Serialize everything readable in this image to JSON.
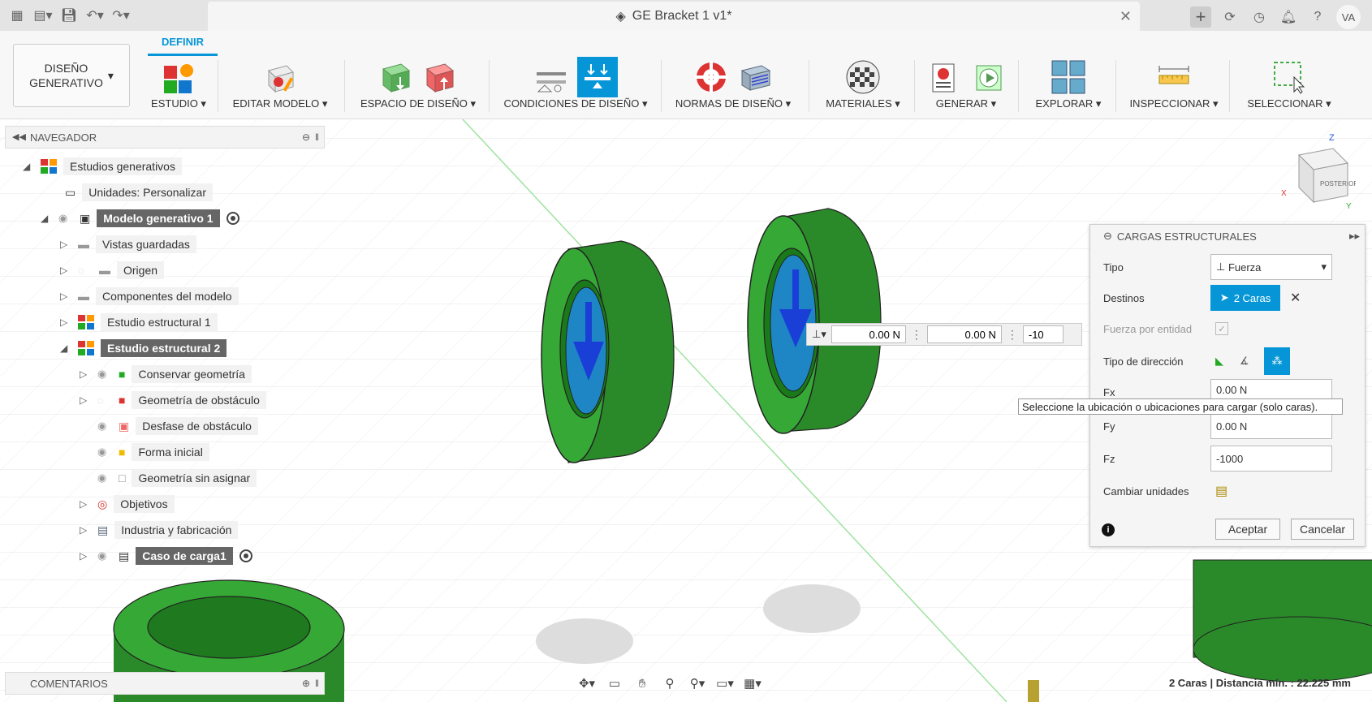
{
  "window": {
    "title": "GE Bracket 1 v1*",
    "avatar": "VA"
  },
  "ribbon": {
    "workspace": "DISEÑO\nGENERATIVO",
    "active_tab": "DEFINIR",
    "groups": [
      {
        "label": "ESTUDIO ▾"
      },
      {
        "label": "EDITAR MODELO ▾"
      },
      {
        "label": "ESPACIO DE DISEÑO ▾"
      },
      {
        "label": "CONDICIONES DE DISEÑO ▾"
      },
      {
        "label": "NORMAS DE DISEÑO ▾"
      },
      {
        "label": "MATERIALES ▾"
      },
      {
        "label": "GENERAR ▾"
      },
      {
        "label": "EXPLORAR ▾"
      },
      {
        "label": "INSPECCIONAR ▾"
      },
      {
        "label": "SELECCIONAR ▾"
      }
    ]
  },
  "navigator": {
    "title": "NAVEGADOR",
    "items": [
      {
        "label": "Estudios generativos"
      },
      {
        "label": "Unidades: Personalizar"
      },
      {
        "label": "Modelo generativo 1"
      },
      {
        "label": "Vistas guardadas"
      },
      {
        "label": "Origen"
      },
      {
        "label": "Componentes del modelo"
      },
      {
        "label": "Estudio estructural 1"
      },
      {
        "label": "Estudio estructural 2"
      },
      {
        "label": "Conservar geometría"
      },
      {
        "label": "Geometría de obstáculo"
      },
      {
        "label": "Desfase de obstáculo"
      },
      {
        "label": "Forma inicial"
      },
      {
        "label": "Geometría sin asignar"
      },
      {
        "label": "Objetivos"
      },
      {
        "label": "Industria y fabricación"
      },
      {
        "label": "Caso de carga1"
      }
    ]
  },
  "field_bar": {
    "fx": "0.00 N",
    "fy": "0.00 N",
    "fz": "-10"
  },
  "dialog": {
    "title": "CARGAS ESTRUCTURALES",
    "tipo_label": "Tipo",
    "tipo_value": "Fuerza",
    "destinos_label": "Destinos",
    "destinos_value": "2 Caras",
    "fuerza_entidad_label": "Fuerza por entidad",
    "tipo_direccion_label": "Tipo de dirección",
    "fx_label": "Fx",
    "fx_value": "0.00 N",
    "fy_label": "Fy",
    "fy_value": "0.00 N",
    "fz_label": "Fz",
    "fz_value": "-1000",
    "cambiar_unidades_label": "Cambiar unidades",
    "ok": "Aceptar",
    "cancel": "Cancelar"
  },
  "tooltip": "Seleccione la ubicación o ubicaciones para cargar (solo caras).",
  "comments": {
    "title": "COMENTARIOS"
  },
  "status": "2 Caras | Distancia mín. : 22.225 mm",
  "viewcube": {
    "face": "POSTERIOR",
    "z": "Z",
    "x": "X",
    "y": "Y"
  },
  "colors": {
    "accent": "#0696d7",
    "part_green": "#2f9a2f",
    "face_blue": "#1f86c6"
  }
}
